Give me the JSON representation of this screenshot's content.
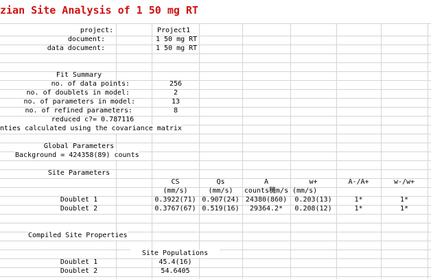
{
  "title": "zian Site Analysis of 1 50 mg RT",
  "info": {
    "project_label": "project:",
    "project_value": "Project1",
    "document_label": "document:",
    "document_value": "1 50 mg RT",
    "data_document_label": "data document:",
    "data_document_value": "1 50 mg RT"
  },
  "fit_summary": {
    "heading": "Fit Summary",
    "data_points_label": "no. of data points:",
    "data_points_value": "256",
    "doublets_label": "no. of doublets in model:",
    "doublets_value": "2",
    "parameters_label": "no. of parameters in model:",
    "parameters_value": "13",
    "refined_label": "no. of refined parameters:",
    "refined_value": "8",
    "reduced_chi": "reduced c?= 0.787116",
    "uncertainty_note": "nties calculated using the covariance matrix"
  },
  "global": {
    "heading": "Global Parameters",
    "background": "Background = 424358(89) counts"
  },
  "site_params": {
    "heading": "Site Parameters",
    "headers": [
      "CS",
      "Qs",
      "A",
      "w+",
      "A-/A+",
      "w-/w+"
    ],
    "units": [
      "(mm/s)",
      "(mm/s)",
      "counts穖m/s",
      "(mm/s)"
    ],
    "rows": [
      {
        "name": "Doublet 1",
        "values": [
          "0.3922(71)",
          "0.907(24)",
          "24380(860)",
          "0.203(13)",
          "1*",
          "1*"
        ]
      },
      {
        "name": "Doublet 2",
        "values": [
          "0.3767(67)",
          "0.519(16)",
          "29364.2*",
          "0.208(12)",
          "1*",
          "1*"
        ]
      }
    ]
  },
  "compiled": {
    "heading": "Compiled Site Properties",
    "populations_heading": "Site Populations",
    "rows": [
      {
        "name": "Doublet 1",
        "value": "45.4(16)"
      },
      {
        "name": "Doublet 2",
        "value": "54.6405"
      }
    ]
  }
}
